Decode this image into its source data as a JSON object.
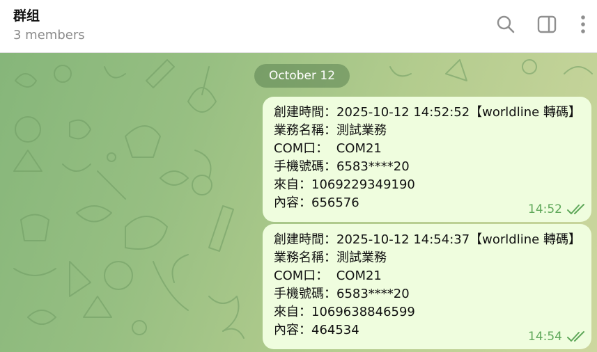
{
  "header": {
    "title": "群组",
    "subtitle": "3 members",
    "icons": [
      "search-icon",
      "sidebar-toggle-icon",
      "more-vertical-icon"
    ]
  },
  "chat": {
    "date_label": "October 12",
    "messages": [
      {
        "lines": [
          "創建時間：2025-10-12 14:52:52【worldline 轉碼】",
          "業務名稱：測試業務",
          "COM口：  COM21",
          "手機號碼：6583****20",
          "來自：1069229349190",
          "內容：656576"
        ],
        "time": "14:52",
        "status": "read"
      },
      {
        "lines": [
          "創建時間：2025-10-12 14:54:37【worldline 轉碼】",
          "業務名稱：測試業務",
          "COM口：  COM21",
          "手機號碼：6583****20",
          "來自：1069638846599",
          "內容：464534"
        ],
        "time": "14:54",
        "status": "read"
      }
    ]
  },
  "colors": {
    "bubble": "#effdde",
    "accent": "#5fa85a",
    "header_bg": "#ffffff"
  }
}
